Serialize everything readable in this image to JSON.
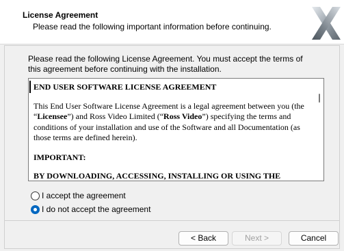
{
  "header": {
    "title": "License Agreement",
    "subtitle": "Please read the following important information before continuing."
  },
  "intro": "Please read the following License Agreement. You must accept the terms of this agreement before continuing with the installation.",
  "license": {
    "heading": "END USER SOFTWARE LICENSE AGREEMENT",
    "paragraph_parts": [
      "This End User Software License Agreement is a legal agreement between you (the “",
      "Licensee",
      "”) and Ross Video Limited (“",
      "Ross Video",
      "”) specifying the terms and conditions of your installation and use of the Software and all Documentation (as those terms are defined herein)."
    ],
    "important": "IMPORTANT:",
    "cutoff": "BY DOWNLOADING, ACCESSING, INSTALLING OR USING THE"
  },
  "options": {
    "accept": "I accept the agreement",
    "decline": "I do not accept the agreement",
    "selected": "decline"
  },
  "buttons": {
    "back": "< Back",
    "next": "Next >",
    "cancel": "Cancel"
  },
  "colors": {
    "accent": "#0067c0",
    "header_bg": "#ffffff",
    "dialog_bg": "#f0f0f0"
  },
  "icons": {
    "logo": "installer-x-logo-icon"
  }
}
